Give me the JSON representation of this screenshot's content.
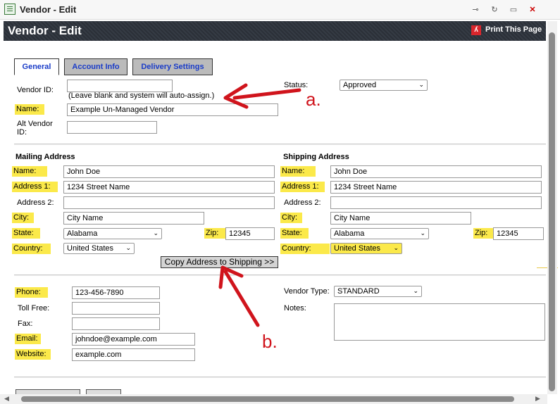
{
  "window": {
    "title": "Vendor - Edit"
  },
  "header": {
    "title": "Vendor - Edit",
    "print_label": "Print This Page"
  },
  "tabs": [
    {
      "label": "General",
      "active": true
    },
    {
      "label": "Account Info",
      "active": false
    },
    {
      "label": "Delivery Settings",
      "active": false
    }
  ],
  "general": {
    "vendor_id_label": "Vendor ID:",
    "vendor_id_value": "",
    "vendor_id_hint": "(Leave blank and system will auto-assign.)",
    "status_label": "Status:",
    "status_value": "Approved",
    "name_label": "Name:",
    "name_value": "Example Un-Managed Vendor",
    "alt_id_label_1": "Alt Vendor",
    "alt_id_label_2": "ID:",
    "alt_id_value": ""
  },
  "mailing": {
    "title": "Mailing Address",
    "name_label": "Name:",
    "name_value": "John Doe",
    "address1_label": "Address 1:",
    "address1_value": "1234 Street Name",
    "address2_label": "Address 2:",
    "address2_value": "",
    "city_label": "City:",
    "city_value": "City Name",
    "state_label": "State:",
    "state_value": "Alabama",
    "zip_label": "Zip:",
    "zip_value": "12345",
    "country_label": "Country:",
    "country_value": "United States"
  },
  "shipping": {
    "title": "Shipping Address",
    "name_label": "Name:",
    "name_value": "John Doe",
    "address1_label": "Address 1:",
    "address1_value": "1234 Street Name",
    "address2_label": "Address 2:",
    "address2_value": "",
    "city_label": "City:",
    "city_value": "City Name",
    "state_label": "State:",
    "state_value": "Alabama",
    "zip_label": "Zip:",
    "zip_value": "12345",
    "country_label": "Country:",
    "country_value": "United States"
  },
  "copy_button": "Copy Address to Shipping >>",
  "contact": {
    "phone_label": "Phone:",
    "phone_value": "123-456-7890",
    "tollfree_label": "Toll Free:",
    "tollfree_value": "",
    "fax_label": "Fax:",
    "fax_value": "",
    "email_label": "Email:",
    "email_value": "johndoe@example.com",
    "website_label": "Website:",
    "website_value": "example.com",
    "vendor_type_label": "Vendor Type:",
    "vendor_type_value": "STANDARD",
    "notes_label": "Notes:",
    "notes_value": ""
  },
  "annotations": {
    "a": "a.",
    "b": "b."
  },
  "colors": {
    "highlight": "#fbe94a",
    "tab_text": "#1a3cc8",
    "annotation": "#d0141c",
    "header_bg": "#2b3038"
  },
  "icons": {
    "window_icon": "document-icon",
    "print_icon": "pdf-icon",
    "window_buttons": [
      "pin-icon",
      "refresh-icon",
      "minimize-icon",
      "close-icon"
    ]
  }
}
